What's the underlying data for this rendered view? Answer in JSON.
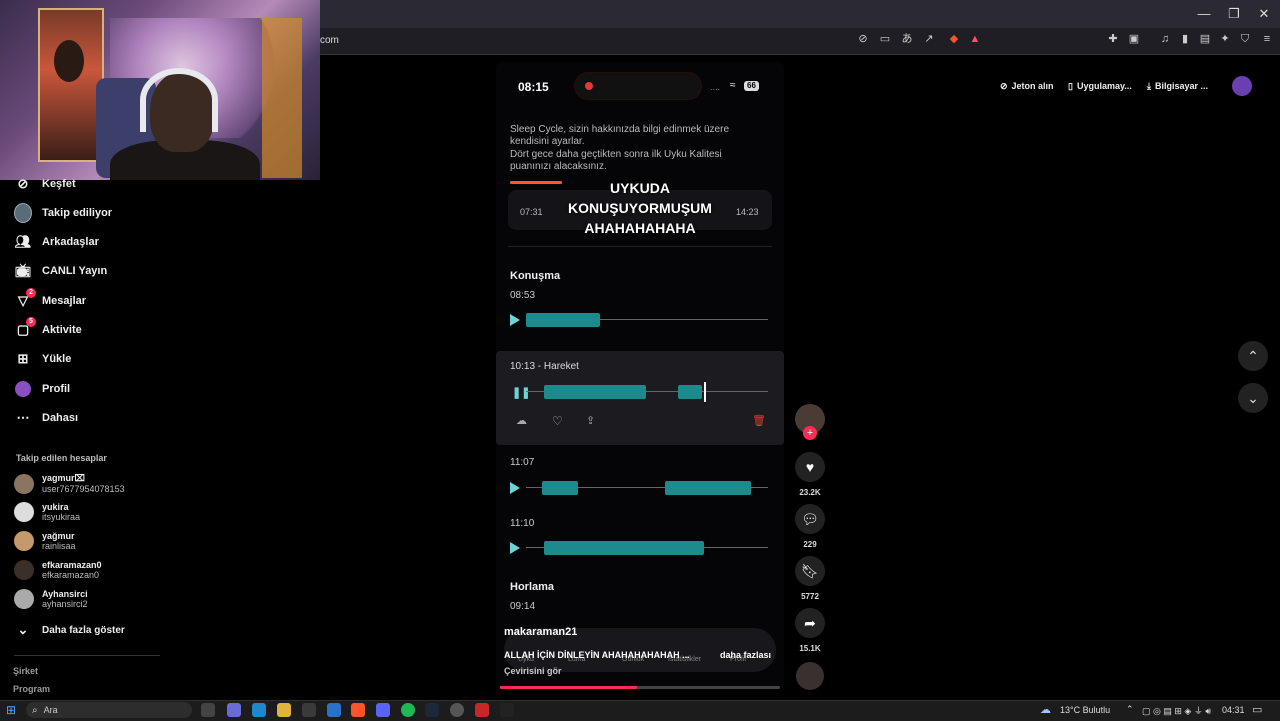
{
  "browser": {
    "url": "com",
    "window_controls": [
      "minimize-icon",
      "restore-icon",
      "close-icon"
    ]
  },
  "header": {
    "get_coins": "Jeton alın",
    "app": "Uygulamay...",
    "desktop": "Bilgisayar ..."
  },
  "sidebar": {
    "items": [
      {
        "label": "Keşfet",
        "icon": "compass-icon"
      },
      {
        "label": "Takip ediliyor",
        "icon": "following-avatar-icon"
      },
      {
        "label": "Arkadaşlar",
        "icon": "friends-icon"
      },
      {
        "label": "CANLI Yayın",
        "icon": "live-icon"
      },
      {
        "label": "Mesajlar",
        "icon": "messages-icon",
        "badge": "2"
      },
      {
        "label": "Aktivite",
        "icon": "activity-icon",
        "badge": "5"
      },
      {
        "label": "Yükle",
        "icon": "upload-icon"
      },
      {
        "label": "Profil",
        "icon": "profile-icon"
      },
      {
        "label": "Dahası",
        "icon": "more-icon"
      }
    ],
    "following_title": "Takip edilen hesaplar",
    "accounts": [
      {
        "name": "yagmur⌧",
        "user": "user7677954078153"
      },
      {
        "name": "yukira",
        "user": "itsyukiraa"
      },
      {
        "name": "yağmur",
        "user": "rainlisaa"
      },
      {
        "name": "efkaramazan0",
        "user": "efkaramazan0"
      },
      {
        "name": "Ayhansirci",
        "user": "ayhansirci2"
      }
    ],
    "show_more": "Daha fazla göster",
    "footer": [
      "Şirket",
      "Program"
    ]
  },
  "video": {
    "status_time": "08:15",
    "battery": "66",
    "info_text_1": "Sleep Cycle, sizin hakkınızda bilgi edinmek üzere kendisini ayarlar.",
    "info_text_2": "Dört gece daha geçtikten sonra ilk Uyku Kalitesi puanınızı alacaksınız.",
    "range_start": "07:31",
    "range_end": "14:23",
    "caption_line1": "UYKUDA",
    "caption_line2": "KONUŞUYORMUŞUM",
    "caption_line3": "AHAHAHAHAHA",
    "sections": {
      "talking": "Konuşma",
      "snoring": "Horlama"
    },
    "clips": [
      {
        "time": "08:53"
      },
      {
        "time": "10:13 - Hareket"
      },
      {
        "time": "11:07"
      },
      {
        "time": "11:10"
      },
      {
        "time": "09:14"
      }
    ],
    "tabbar": [
      "Uyku",
      "Luma",
      "Günlük",
      "İstatistikler",
      "Profil"
    ],
    "author": "makaraman21",
    "description": "ALLAH İÇİN DİNLEYİN AHAHAHAHAHAH ...",
    "more": "daha fazlası",
    "translate": "Çevirisini gör",
    "progress": 0.49
  },
  "actions": {
    "likes": "23.2K",
    "comments": "229",
    "saves": "5772",
    "shares": "15.1K"
  },
  "taskbar": {
    "search": "Ara",
    "weather": "13°C  Bulutlu",
    "clock": "04:31"
  },
  "colors": {
    "accent": "#fe2c55",
    "wave": "#1d8b8e",
    "background": "#000000"
  }
}
